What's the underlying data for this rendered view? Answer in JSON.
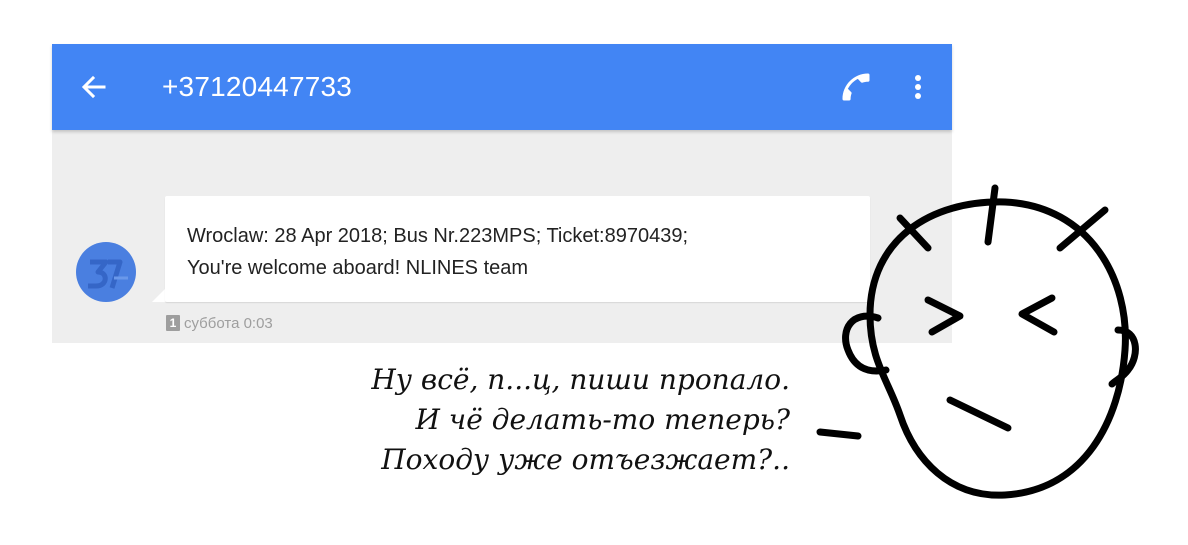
{
  "appbar": {
    "title": "+37120447733",
    "back_icon": "arrow-back-icon",
    "call_icon": "phone-icon",
    "more_icon": "more-vert-icon",
    "color": "#4285f4"
  },
  "conversation": {
    "background": "#eeeeee",
    "message": {
      "text": "Wroclaw: 28 Apr 2018; Bus Nr.223MPS; Ticket:8970439;\nYou're welcome aboard! NLINES team",
      "sim_slot": "1",
      "timestamp": "суббота 0:03"
    },
    "avatar": {
      "icon": "contact-avatar-icon",
      "color": "#4a7fe0"
    }
  },
  "caption": {
    "lines": [
      "Ну всё, п...ц, пиши пропало.",
      "И чё делать-то теперь?",
      "Походу уже отъезжает?.."
    ]
  },
  "illustration": {
    "icon": "stressed-face-doodle"
  }
}
